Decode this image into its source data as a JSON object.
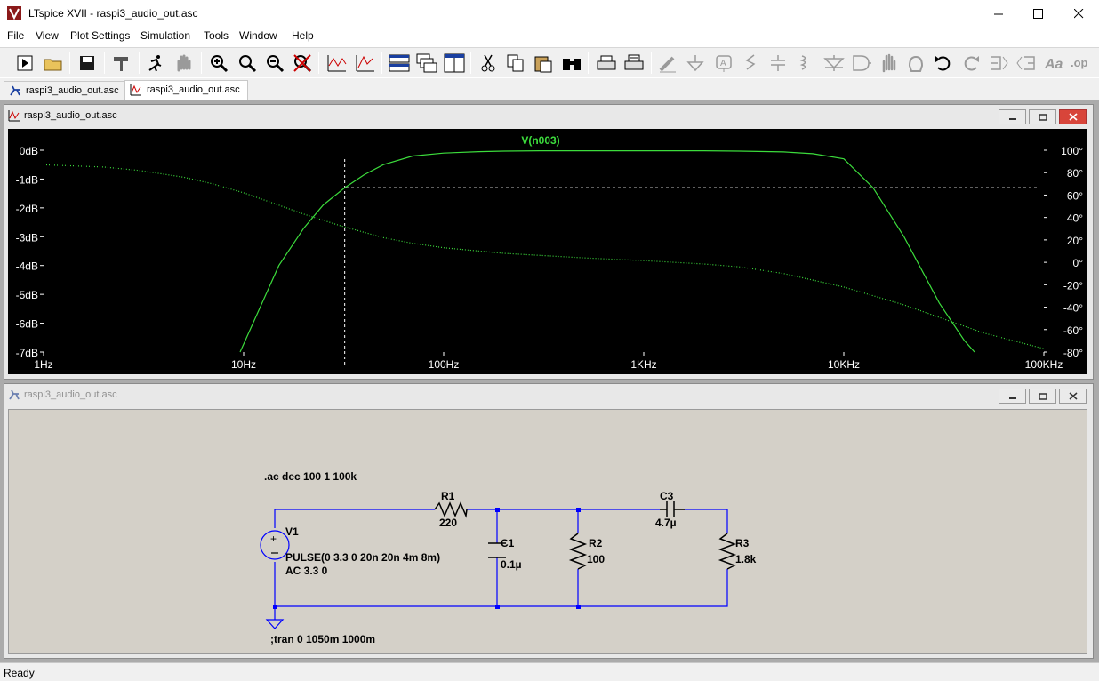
{
  "window": {
    "title": "LTspice XVII - raspi3_audio_out.asc"
  },
  "menu": [
    "File",
    "View",
    "Plot Settings",
    "Simulation",
    "Tools",
    "Window",
    "Help"
  ],
  "tabs": [
    {
      "label": "raspi3_audio_out.asc",
      "icon": "schematic-icon"
    },
    {
      "label": "raspi3_audio_out.asc",
      "icon": "waveform-icon"
    }
  ],
  "plot_window": {
    "title": "raspi3_audio_out.asc",
    "trace_label": "V(n003)",
    "colors": {
      "background": "#000000",
      "trace": "#3cdc3c",
      "text": "#ffffff",
      "trace_label": "#3cdc3c"
    }
  },
  "schematic_window": {
    "title": "raspi3_audio_out.asc",
    "directives": {
      "ac": ".ac dec 100 1 100k",
      "tran": ";tran 0 1050m 1000m"
    },
    "components": {
      "V1": {
        "name": "V1",
        "value1": "PULSE(0 3.3 0 20n 20n 4m 8m)",
        "value2": "AC 3.3 0"
      },
      "R1": {
        "name": "R1",
        "value": "220"
      },
      "C1": {
        "name": "C1",
        "value": "0.1µ"
      },
      "R2": {
        "name": "R2",
        "value": "100"
      },
      "C3": {
        "name": "C3",
        "value": "4.7µ"
      },
      "R3": {
        "name": "R3",
        "value": "1.8k"
      }
    },
    "colors": {
      "wire": "#0000ff",
      "background": "#d4d0c8"
    }
  },
  "status": {
    "text": "Ready"
  },
  "chart_data": {
    "type": "line",
    "title": "V(n003)",
    "x_scale": "log",
    "xlim": [
      1,
      100000
    ],
    "x_ticks": [
      "1Hz",
      "10Hz",
      "100Hz",
      "1KHz",
      "10KHz",
      "100KHz"
    ],
    "y_left_ticks": [
      "0dB",
      "-1dB",
      "-2dB",
      "-3dB",
      "-4dB",
      "-5dB",
      "-6dB",
      "-7dB"
    ],
    "y_left_lim": [
      -7,
      0
    ],
    "y_right_ticks": [
      "100°",
      "80°",
      "60°",
      "40°",
      "20°",
      "0°",
      "-20°",
      "-40°",
      "-60°",
      "-80°"
    ],
    "y_right_lim": [
      -80,
      100
    ],
    "cursor": {
      "x": 32,
      "db": -1.3
    },
    "series": [
      {
        "name": "V(n003)",
        "axis": "magnitude_db",
        "style": "solid",
        "x": [
          9.6,
          12,
          15,
          20,
          25,
          32,
          40,
          50,
          70,
          100,
          150,
          200,
          300,
          500,
          1000,
          2000,
          3000,
          5000,
          7000,
          10000,
          14000,
          20000,
          30000,
          40000,
          45000
        ],
        "y": [
          -7.0,
          -5.5,
          -4.0,
          -2.7,
          -1.9,
          -1.3,
          -0.85,
          -0.5,
          -0.2,
          -0.1,
          -0.05,
          -0.03,
          -0.02,
          -0.02,
          -0.02,
          -0.02,
          -0.03,
          -0.06,
          -0.12,
          -0.3,
          -1.3,
          -3.0,
          -5.3,
          -6.6,
          -7.0
        ]
      },
      {
        "name": "V(n003)",
        "axis": "phase_deg",
        "style": "dotted",
        "x": [
          1,
          2,
          3,
          5,
          7,
          10,
          15,
          20,
          30,
          50,
          70,
          100,
          200,
          500,
          1000,
          2000,
          3000,
          5000,
          10000,
          20000,
          50000,
          100000
        ],
        "y": [
          87,
          85,
          82,
          76,
          70,
          62,
          51,
          43,
          33,
          22,
          17,
          13,
          8,
          4,
          1.5,
          -1.5,
          -4,
          -10,
          -22,
          -38,
          -63,
          -77
        ]
      }
    ]
  }
}
